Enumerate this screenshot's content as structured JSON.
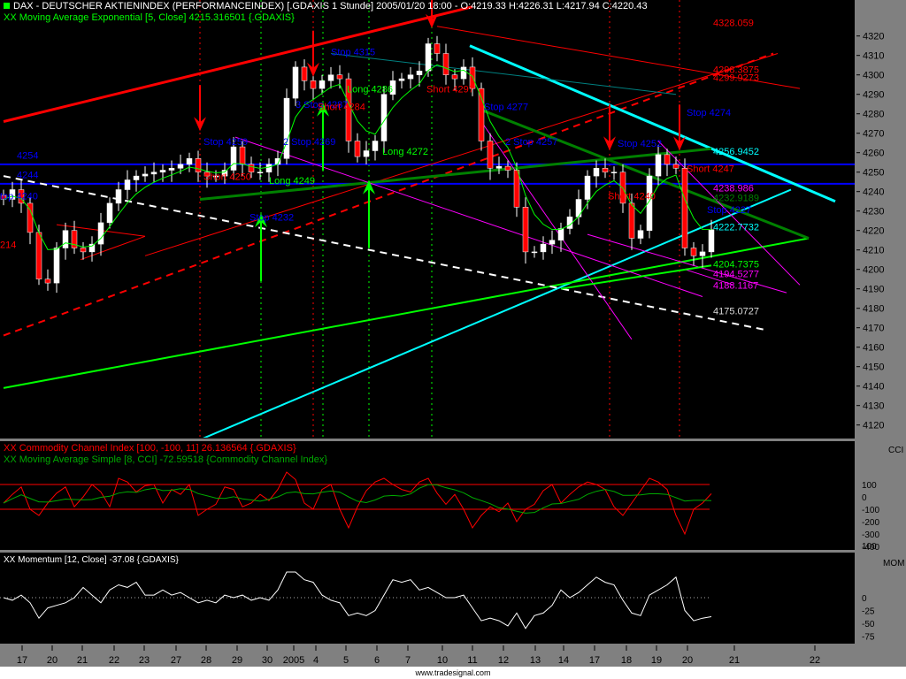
{
  "header": {
    "title": "DAX  - DEUTSCHER AKTIENINDEX (PERFORMANCEINDEX) [.GDAXIS  1 Stunde] 2005/01/20 18:00 - O:4219.33 H:4226.31 L:4217.94 C:4220.43",
    "ema_label": "XX Moving Average Exponential [5, Close] 4215.316501 {.GDAXIS}",
    "cci_label": "XX Commodity Channel Index [100, -100, 11] 26.136564 {.GDAXIS}",
    "cci_ma_label": "XX Moving Average Simple [8, CCI] -72.59518 {Commodity Channel Index}",
    "mom_label": "XX Momentum [12, Close] -37.08 {.GDAXIS}"
  },
  "footer": "www.tradesignal.com",
  "colors": {
    "up": "#ffffff",
    "down": "#ff0000",
    "ema": "#00ff00",
    "axis_bg": "#808080",
    "blue": "#0000ff",
    "cyan": "#00ffff",
    "red": "#ff0000",
    "magenta": "#ff00ff",
    "darkgreen": "#008000",
    "green": "#00ff00",
    "teal": "#008080"
  },
  "chart_data": [
    {
      "type": "candlestick",
      "title": "DAX 1 Stunde",
      "ylim": [
        4112,
        4340
      ],
      "yticks": [
        4320,
        4310,
        4300,
        4290,
        4280,
        4270,
        4260,
        4250,
        4240,
        4230,
        4220,
        4210,
        4200,
        4190,
        4180,
        4170,
        4160,
        4150,
        4140,
        4130,
        4120
      ],
      "xticks": [
        {
          "label": "17",
          "i": 2.5
        },
        {
          "label": "20",
          "i": 5.9
        },
        {
          "label": "21",
          "i": 9.3
        },
        {
          "label": "22",
          "i": 12.9
        },
        {
          "label": "23",
          "i": 16.3
        },
        {
          "label": "27",
          "i": 19.9
        },
        {
          "label": "28",
          "i": 23.3
        },
        {
          "label": "29",
          "i": 26.8
        },
        {
          "label": "30",
          "i": 30.2
        },
        {
          "label": "2005",
          "i": 33.2
        },
        {
          "label": "4",
          "i": 35.7
        },
        {
          "label": "5",
          "i": 39.1
        },
        {
          "label": "6",
          "i": 42.6
        },
        {
          "label": "7",
          "i": 46.1
        },
        {
          "label": "10",
          "i": 50
        },
        {
          "label": "11",
          "i": 53.4
        },
        {
          "label": "12",
          "i": 56.9
        },
        {
          "label": "13",
          "i": 60.5
        },
        {
          "label": "14",
          "i": 63.7
        },
        {
          "label": "17",
          "i": 67.2
        },
        {
          "label": "18",
          "i": 70.8
        },
        {
          "label": "19",
          "i": 74.2
        },
        {
          "label": "20",
          "i": 77.7
        },
        {
          "label": "21",
          "i": 83
        },
        {
          "label": "22",
          "i": 92.1
        }
      ],
      "close": [
        4236,
        4241,
        4234,
        4219,
        4195,
        4193,
        4211,
        4220,
        4211,
        4209,
        4213,
        4224,
        4234,
        4241,
        4246,
        4248,
        4249,
        4250,
        4251,
        4252,
        4254,
        4257,
        4250,
        4248,
        4248,
        4251,
        4263,
        4254,
        4250,
        4250,
        4254,
        4257,
        4288,
        4304,
        4297,
        4293,
        4297,
        4300,
        4298,
        4266,
        4258,
        4261,
        4266,
        4290,
        4297,
        4298,
        4300,
        4302,
        4316,
        4311,
        4300,
        4298,
        4304,
        4293,
        4266,
        4252,
        4253,
        4251,
        4232,
        4209,
        4209,
        4213,
        4215,
        4221,
        4227,
        4236,
        4248,
        4252,
        4250,
        4250,
        4234,
        4216,
        4220,
        4248,
        4259,
        4254,
        4252,
        4211,
        4207,
        4209,
        4220.43
      ],
      "hlines": [
        {
          "p": 4254,
          "label": "4254"
        },
        {
          "p": 4244,
          "label": "4244"
        }
      ],
      "lines": [
        {
          "c": "red",
          "w": 3,
          "i1": 0,
          "p1": 4276,
          "i2": 53,
          "p2": 4335
        },
        {
          "c": "red",
          "w": 2,
          "dash": true,
          "i1": 0,
          "p1": 4166,
          "i2": 87,
          "p2": 4311
        },
        {
          "c": "red",
          "w": 1,
          "i1": 16,
          "p1": 4207,
          "i2": 87.5,
          "p2": 4311
        },
        {
          "c": "red",
          "w": 1,
          "i1": 49,
          "p1": 4325,
          "i2": 90,
          "p2": 4293
        },
        {
          "c": "red",
          "w": 1,
          "i1": 6,
          "p1": 4223,
          "i2": 16,
          "p2": 4217
        },
        {
          "c": "red",
          "w": 1,
          "i1": 8.7,
          "p1": 4205,
          "i2": 16,
          "p2": 4217
        },
        {
          "c": "cyan",
          "w": 3,
          "i1": 52.7,
          "p1": 4315,
          "i2": 94,
          "p2": 4235
        },
        {
          "c": "cyan",
          "w": 2,
          "i1": 22.5,
          "p1": 4113,
          "i2": 89,
          "p2": 4241
        },
        {
          "c": "green",
          "w": 2,
          "i1": 0,
          "p1": 4139,
          "i2": 91,
          "p2": 4216
        },
        {
          "c": "darkgreen",
          "w": 3,
          "i1": 22.2,
          "p1": 4236,
          "i2": 80,
          "p2": 4262
        },
        {
          "c": "darkgreen",
          "w": 3,
          "i1": 54,
          "p1": 4282,
          "i2": 91,
          "p2": 4216
        },
        {
          "c": "teal",
          "w": 1,
          "i1": 37,
          "p1": 4311,
          "i2": 76,
          "p2": 4290
        },
        {
          "c": "white",
          "w": 2,
          "dash": true,
          "i1": 0,
          "p1": 4248,
          "i2": 86,
          "p2": 4169
        },
        {
          "c": "magenta",
          "w": 1,
          "i1": 26.2,
          "p1": 4268,
          "i2": 79,
          "p2": 4186
        },
        {
          "c": "magenta",
          "w": 1,
          "i1": 54,
          "p1": 4276,
          "i2": 71,
          "p2": 4164
        },
        {
          "c": "magenta",
          "w": 1,
          "i1": 74,
          "p1": 4266,
          "i2": 90,
          "p2": 4192
        },
        {
          "c": "magenta",
          "w": 1,
          "i1": 66,
          "p1": 4218,
          "i2": 88.5,
          "p2": 4188
        },
        {
          "c": "magenta",
          "w": 1,
          "i1": 77,
          "p1": 4200,
          "i2": 82.5,
          "p2": 4192
        },
        {
          "c": "green",
          "w": 2,
          "i1": 63,
          "p1": 4190,
          "i2": 80,
          "p2": 4202
        }
      ],
      "arrows_down": [
        {
          "i": 22.2,
          "p": 4272
        },
        {
          "i": 35,
          "p": 4300
        },
        {
          "i": 48.4,
          "p": 4325
        },
        {
          "i": 68.5,
          "p": 4262
        },
        {
          "i": 76.4,
          "p": 4262
        }
      ],
      "arrows_up": [
        {
          "i": 29.1,
          "p": 4228
        },
        {
          "i": 36.1,
          "p": 4285
        },
        {
          "i": 41.3,
          "p": 4245
        }
      ],
      "vlines": [
        {
          "i": 22.2,
          "c": "red"
        },
        {
          "i": 29.1,
          "c": "green"
        },
        {
          "i": 35,
          "c": "red"
        },
        {
          "i": 36.1,
          "c": "green"
        },
        {
          "i": 41.3,
          "c": "green"
        },
        {
          "i": 48.4,
          "c": "green"
        },
        {
          "i": 68.5,
          "c": "red"
        },
        {
          "i": 76.4,
          "c": "red"
        }
      ],
      "annotations": [
        {
          "text": "4254",
          "c": "blue",
          "i": 1.5,
          "p": 4257
        },
        {
          "text": "4244",
          "c": "blue",
          "i": 1.5,
          "p": 4247
        },
        {
          "text": "top 4240",
          "c": "blue",
          "i": 0,
          "p": 4236
        },
        {
          "text": "214",
          "c": "red",
          "i": 0,
          "p": 4211
        },
        {
          "text": "Stop 4259",
          "c": "blue",
          "i": 22.6,
          "p": 4264
        },
        {
          "text": "Short 4250",
          "c": "red",
          "i": 22.6,
          "p": 4246
        },
        {
          "text": "Long 4249",
          "c": "green",
          "i": 30,
          "p": 4244
        },
        {
          "text": "Stop 4232",
          "c": "blue",
          "i": 27.8,
          "p": 4225
        },
        {
          "text": "2 Stop 4269",
          "c": "blue",
          "i": 31.6,
          "p": 4264
        },
        {
          "text": "3 Stop 4287",
          "c": "blue",
          "i": 33,
          "p": 4283
        },
        {
          "text": "Short 4284",
          "c": "red",
          "i": 35.5,
          "p": 4282
        },
        {
          "text": "Stop 4315",
          "c": "blue",
          "i": 37,
          "p": 4310
        },
        {
          "text": "Long 4286",
          "c": "green",
          "i": 38.8,
          "p": 4291
        },
        {
          "text": "Long 4272",
          "c": "green",
          "i": 42.8,
          "p": 4259
        },
        {
          "text": "Short 4297",
          "c": "red",
          "i": 47.8,
          "p": 4291
        },
        {
          "text": "Stop 4277",
          "c": "blue",
          "i": 54.3,
          "p": 4282
        },
        {
          "text": "2 Stop 4257",
          "c": "blue",
          "i": 56.7,
          "p": 4264
        },
        {
          "text": "Stop 4252",
          "c": "blue",
          "i": 69.4,
          "p": 4263
        },
        {
          "text": "Short 4240",
          "c": "red",
          "i": 68.3,
          "p": 4236
        },
        {
          "text": "Stop 4274",
          "c": "blue",
          "i": 77.2,
          "p": 4279
        },
        {
          "text": "Short 4247",
          "c": "red",
          "i": 77.2,
          "p": 4250
        },
        {
          "text": "4328.059",
          "c": "red",
          "i": 80.2,
          "p": 4325
        },
        {
          "text": "4298.3875",
          "c": "red",
          "i": 80.2,
          "p": 4301
        },
        {
          "text": "4299.9273",
          "c": "red",
          "i": 80.2,
          "p": 4297
        },
        {
          "text": "4256.9452",
          "c": "cyan",
          "i": 80.2,
          "p": 4259
        },
        {
          "text": "4238.986",
          "c": "magenta",
          "i": 80.2,
          "p": 4240
        },
        {
          "text": "4232.9189",
          "c": "darkgreen",
          "i": 80.2,
          "p": 4235
        },
        {
          "text": "Stop 4227",
          "c": "blue",
          "i": 79.5,
          "p": 4229
        },
        {
          "text": "4222.7732",
          "c": "cyan",
          "i": 80.2,
          "p": 4220
        },
        {
          "text": "4204.7375",
          "c": "green",
          "i": 80.2,
          "p": 4201
        },
        {
          "text": "4194.5277",
          "c": "magenta",
          "i": 80.2,
          "p": 4196
        },
        {
          "text": "4188.1167",
          "c": "magenta",
          "i": 80.2,
          "p": 4190
        },
        {
          "text": "4175.0727",
          "c": "lightgray",
          "i": 80.2,
          "p": 4177
        }
      ]
    },
    {
      "type": "line",
      "title": "Commodity Channel Index",
      "axis_label": "CCI",
      "yticks": [
        100,
        0,
        -100,
        -200,
        -300,
        -400
      ],
      "bands": [
        100,
        -100
      ],
      "values": [
        -50,
        20,
        80,
        -100,
        -150,
        -50,
        30,
        80,
        -80,
        0,
        100,
        40,
        -80,
        150,
        120,
        40,
        90,
        100,
        -50,
        60,
        20,
        100,
        -150,
        -100,
        -60,
        80,
        60,
        -80,
        -50,
        20,
        -30,
        60,
        200,
        140,
        -50,
        -100,
        60,
        100,
        -100,
        -250,
        -80,
        50,
        120,
        150,
        100,
        60,
        40,
        120,
        150,
        30,
        -60,
        20,
        -100,
        -250,
        -150,
        -80,
        -120,
        -50,
        -200,
        -100,
        -60,
        50,
        100,
        -50,
        20,
        80,
        120,
        100,
        60,
        -80,
        -150,
        -50,
        50,
        150,
        120,
        60,
        -150,
        -300,
        -100,
        -50,
        26
      ]
    },
    {
      "type": "line",
      "title": "Momentum",
      "axis_label": "MOM",
      "yticks": [
        100,
        0,
        -25,
        -50,
        -75
      ],
      "values": [
        0,
        -5,
        5,
        -10,
        -40,
        -20,
        -15,
        -10,
        0,
        20,
        5,
        -10,
        15,
        25,
        20,
        30,
        5,
        5,
        15,
        5,
        10,
        0,
        -10,
        -5,
        -10,
        5,
        0,
        5,
        -5,
        0,
        -5,
        15,
        50,
        50,
        35,
        30,
        5,
        -5,
        -10,
        -35,
        -30,
        -35,
        -25,
        5,
        35,
        30,
        35,
        15,
        20,
        10,
        0,
        0,
        5,
        -20,
        -45,
        -40,
        -45,
        -55,
        -30,
        -60,
        -35,
        -30,
        -15,
        15,
        0,
        10,
        25,
        40,
        30,
        25,
        -5,
        -30,
        -35,
        5,
        15,
        25,
        40,
        -25,
        -45,
        -40,
        -37.08
      ]
    }
  ]
}
